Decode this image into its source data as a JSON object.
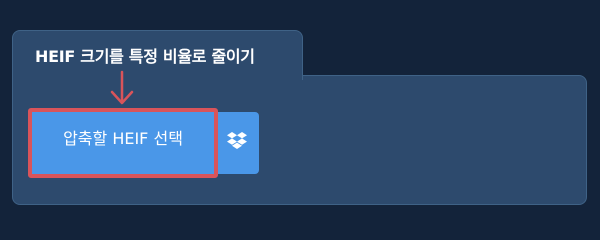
{
  "panel": {
    "title": "HEIF 크기를 특정 비율로 줄이기"
  },
  "upload": {
    "button_label": "압축할 HEIF 선택",
    "dropbox_icon": "dropbox-icon"
  },
  "colors": {
    "background": "#13233a",
    "panel": "#2d4a6d",
    "button": "#4a97e8",
    "highlight": "#d9545a"
  }
}
